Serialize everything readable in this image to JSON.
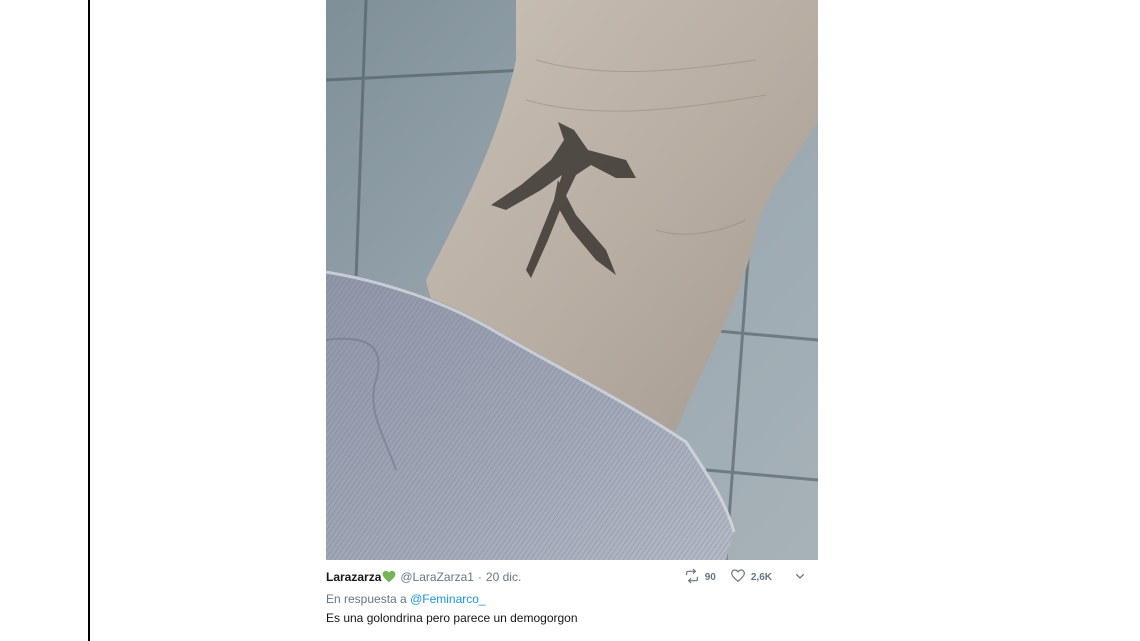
{
  "tweet": {
    "author_name": "Larazarza",
    "author_emoji": "green-heart-icon",
    "handle": "@LaraZarza1",
    "separator": "·",
    "date": "20 dic.",
    "reply_prefix": "En respuesta a",
    "reply_to": "@Feminarco_",
    "text": "Es una golondrina pero parece un demogorgon",
    "retweets": "90",
    "likes": "2,6K"
  },
  "icons": {
    "retweet": "retweet-icon",
    "like": "heart-outline-icon",
    "more": "chevron-down-icon"
  },
  "colors": {
    "link": "#1b95e0",
    "muted": "#657786",
    "text": "#14171a",
    "emoji_green": "#77b255"
  }
}
